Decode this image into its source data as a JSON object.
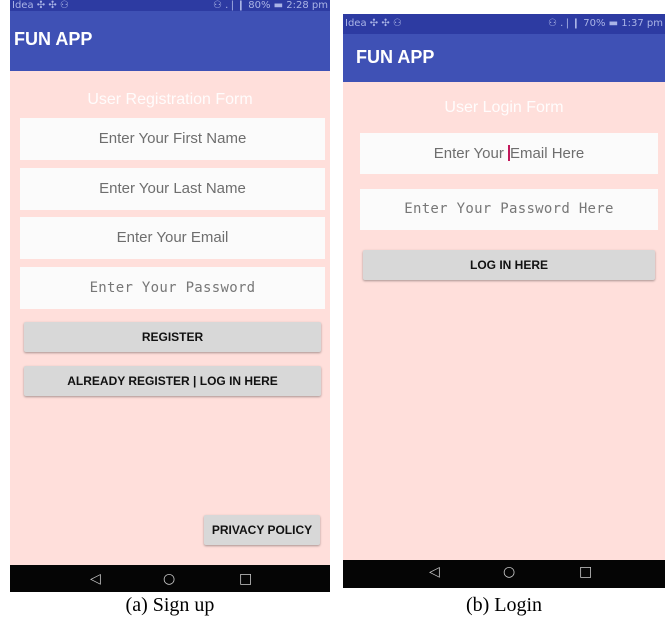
{
  "signup": {
    "status": {
      "carrier": "Idea ✣ ✣ ⚇",
      "right": "⚇ .❘❙ 80% ▬ 2:28 pm"
    },
    "app_title": "FUN APP",
    "form_title": "User Registration Form",
    "fields": {
      "first_name": "Enter Your First Name",
      "last_name": "Enter Your Last Name",
      "email": "Enter Your Email",
      "password": "Enter Your Password"
    },
    "buttons": {
      "register": "REGISTER",
      "login_link": "ALREADY REGISTER | LOG IN HERE",
      "privacy": "PRIVACY POLICY"
    },
    "caption": "(a) Sign up"
  },
  "login": {
    "status": {
      "carrier": "Idea ✣ ✣ ⚇",
      "right": "⚇ .❘❙ 70% ▬ 1:37 pm"
    },
    "app_title": "FUN APP",
    "form_title": "User Login Form",
    "fields": {
      "email_before": "Enter Your ",
      "email_after": "Email Here",
      "password": "Enter Your Password Here"
    },
    "buttons": {
      "login": "LOG IN HERE"
    },
    "caption": "(b) Login"
  },
  "nav_icons": {
    "back": "◁",
    "home": "○",
    "recents": "□"
  },
  "colors": {
    "app_bar": "#3f51b5",
    "status_bar": "#2d3ba2",
    "background": "#ffdfdb",
    "button": "#d8d8d8"
  }
}
